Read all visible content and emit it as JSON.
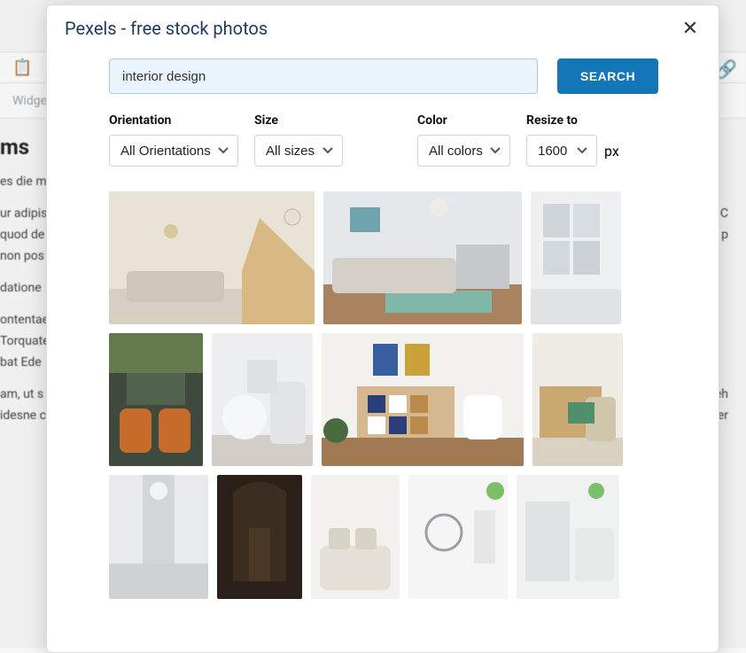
{
  "bg": {
    "clipboard_icon": "📋",
    "widget_text": "Widget",
    "heading": "ms",
    "para1": "es die mo",
    "para2a": "ur adipis",
    "para2b": "emia. C",
    "para3a": "quod de",
    "para3b": "uor, p",
    "para4": "non pos",
    "para5": "datione",
    "para6": "ontentae",
    "para7": "Torquate",
    "para8": "bat Ede",
    "para9a": "am, ut s",
    "para9b": "repreh",
    "para10a": "idesne c",
    "para10b": "doler"
  },
  "modal": {
    "title": "Pexels - free stock photos",
    "close": "✕",
    "search": {
      "value": "interior design",
      "button": "SEARCH"
    },
    "filters": {
      "orientation": {
        "label": "Orientation",
        "value": "All Orientations"
      },
      "size": {
        "label": "Size",
        "value": "All sizes"
      },
      "color": {
        "label": "Color",
        "value": "All colors"
      },
      "resize": {
        "label": "Resize to",
        "value": "1600",
        "suffix": "px"
      }
    }
  }
}
